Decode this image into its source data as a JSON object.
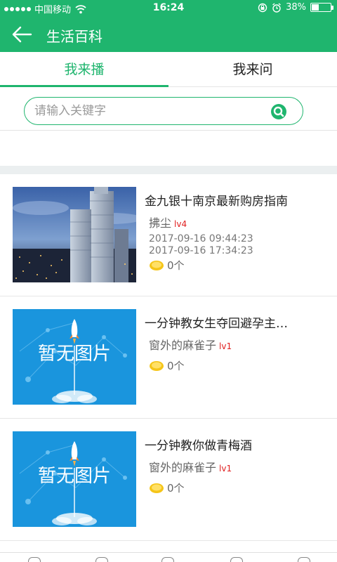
{
  "status_bar": {
    "carrier": "中国移动",
    "time": "16:24",
    "battery_text": "38%",
    "battery_level": 0.38
  },
  "nav": {
    "title": "生活百科"
  },
  "tabs": [
    {
      "label": "我来播",
      "active": true
    },
    {
      "label": "我来问",
      "active": false
    }
  ],
  "search": {
    "placeholder": "请输入关键字",
    "value": ""
  },
  "colors": {
    "brand": "#1fb56e",
    "level": "#e02020",
    "coin": "#f5c518",
    "thumb_blue": "#1a95dd"
  },
  "items": [
    {
      "title": "金九银十南京最新购房指南",
      "author": "拂尘",
      "level": "lv4",
      "dates": [
        "2017-09-16 09:44:23",
        "2017-09-16 17:34:23"
      ],
      "coins": "0个",
      "thumb": "city-photo"
    },
    {
      "title": "一分钟教女生夺回避孕主…",
      "author": "窗外的麻雀子",
      "level": "lv1",
      "dates": [],
      "coins": "0个",
      "thumb": "no-image",
      "thumb_text": "暂无图片"
    },
    {
      "title": "一分钟教你做青梅酒",
      "author": "窗外的麻雀子",
      "level": "lv1",
      "dates": [],
      "coins": "0个",
      "thumb": "no-image",
      "thumb_text": "暂无图片"
    }
  ]
}
